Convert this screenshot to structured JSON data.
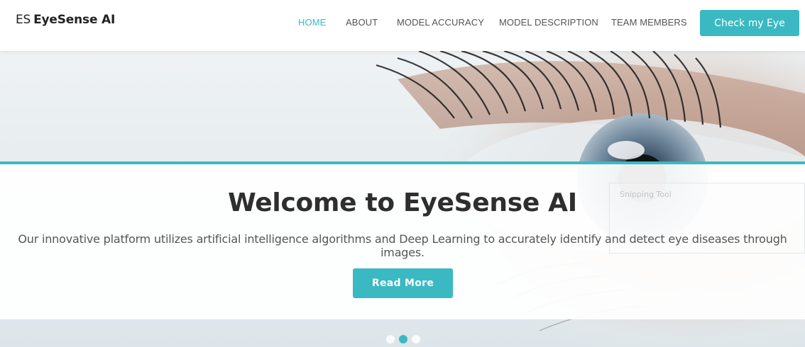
{
  "header": {
    "logo_mark": "ES",
    "logo_text": "EyeSense AI",
    "nav": [
      {
        "label": "HOME",
        "active": true
      },
      {
        "label": "ABOUT",
        "active": false
      },
      {
        "label": "MODEL ACCURACY",
        "active": false
      },
      {
        "label": "MODEL DESCRIPTION",
        "active": false
      },
      {
        "label": "TEAM MEMBERS",
        "active": false
      }
    ],
    "cta_label": "Check my Eye"
  },
  "hero": {
    "title": "Welcome to EyeSense AI",
    "description": "Our innovative platform utilizes artificial intelligence algorithms and Deep Learning to accurately identify and detect eye diseases through images.",
    "button_label": "Read More",
    "overlay_window_title": "Snipping Tool",
    "slides": 3,
    "active_slide": 2
  },
  "colors": {
    "accent": "#3bb9c2",
    "title_text": "#2e2e2e",
    "nav_text": "#555555"
  }
}
